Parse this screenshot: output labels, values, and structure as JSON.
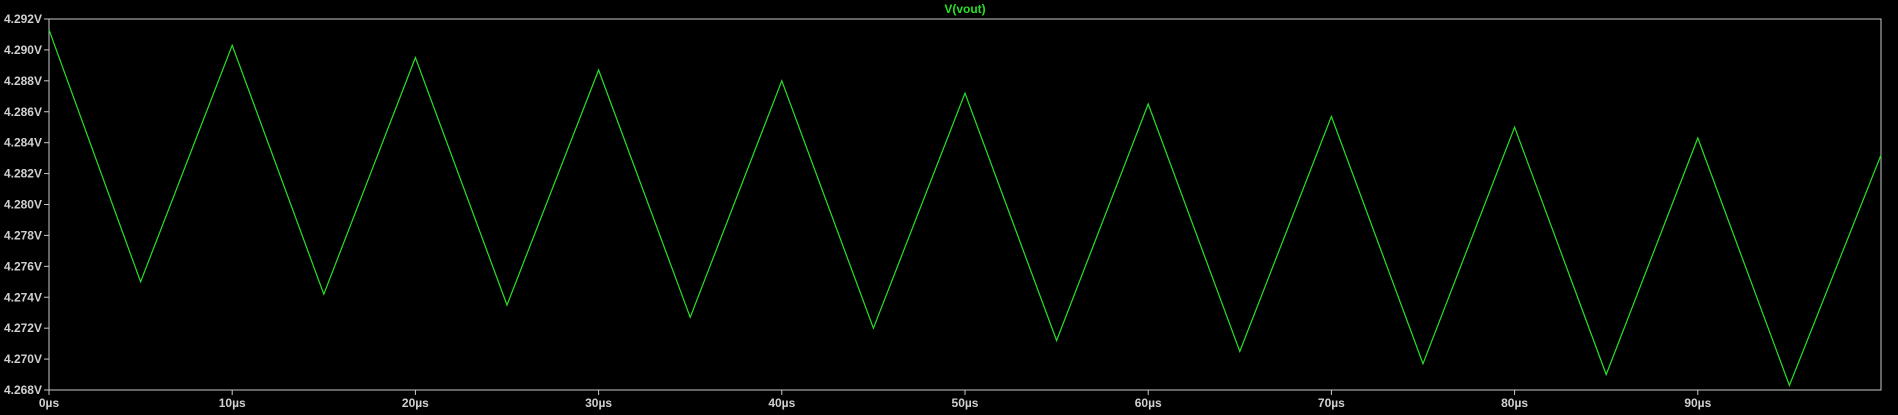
{
  "chart_data": {
    "type": "line",
    "title": "V(vout)",
    "xlabel": "",
    "ylabel": "",
    "xlim": [
      0,
      100
    ],
    "ylim": [
      4.268,
      4.292
    ],
    "x_ticks": [
      0,
      10,
      20,
      30,
      40,
      50,
      60,
      70,
      80,
      90
    ],
    "x_tick_labels": [
      "0µs",
      "10µs",
      "20µs",
      "30µs",
      "40µs",
      "50µs",
      "60µs",
      "70µs",
      "80µs",
      "90µs"
    ],
    "y_ticks": [
      4.268,
      4.27,
      4.272,
      4.274,
      4.276,
      4.278,
      4.28,
      4.282,
      4.284,
      4.286,
      4.288,
      4.29,
      4.292
    ],
    "y_tick_labels": [
      "4.268V",
      "4.270V",
      "4.272V",
      "4.274V",
      "4.276V",
      "4.278V",
      "4.280V",
      "4.282V",
      "4.284V",
      "4.286V",
      "4.288V",
      "4.290V",
      "4.292V"
    ],
    "grid": false,
    "colors": {
      "background": "#000000",
      "axes": "#c8c8c8",
      "trace": "#27e027"
    },
    "series": [
      {
        "name": "V(vout)",
        "x": [
          0,
          5,
          10,
          15,
          20,
          25,
          30,
          35,
          40,
          45,
          50,
          55,
          60,
          65,
          70,
          75,
          80,
          85,
          90,
          95,
          100
        ],
        "y": [
          4.2913,
          4.275,
          4.2903,
          4.2742,
          4.2895,
          4.2735,
          4.2887,
          4.2727,
          4.288,
          4.272,
          4.2872,
          4.2712,
          4.2865,
          4.2705,
          4.2857,
          4.2697,
          4.285,
          4.269,
          4.2843,
          4.2683,
          4.2832
        ]
      }
    ]
  }
}
